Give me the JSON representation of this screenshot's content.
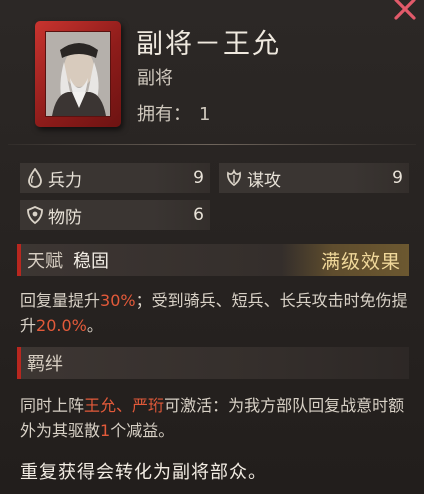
{
  "general": {
    "title": "副将－王允",
    "rank": "副将",
    "owned_label": "拥有：",
    "owned_value": "1"
  },
  "stats": [
    {
      "icon": "troops-icon",
      "label": "兵力",
      "value": "9"
    },
    {
      "icon": "strategy-icon",
      "label": "谋攻",
      "value": "9"
    },
    {
      "icon": "defense-icon",
      "label": "物防",
      "value": "6"
    }
  ],
  "talent": {
    "section_label": "天赋",
    "name": "稳固",
    "badge": "满级效果",
    "desc": {
      "p1": "回复量提升",
      "v1": "30%",
      "p2": "；受到骑兵、短兵、长兵攻击时免伤提升",
      "v2": "20.0%",
      "p3": "。"
    }
  },
  "bond": {
    "section_label": "羁绊",
    "desc": {
      "p1": "同时上阵",
      "n1": "王允",
      "sep": "、",
      "n2": "严珩",
      "p2": "可激活：为我方部队回复战意时额外为其驱散",
      "count": "1",
      "p3": "个减益。"
    }
  },
  "footer_note": "重复获得会转化为副将部众。",
  "colors": {
    "card_red": "#b8271f",
    "highlight": "#e35a3a",
    "badge_gold": "#f0d89a"
  }
}
